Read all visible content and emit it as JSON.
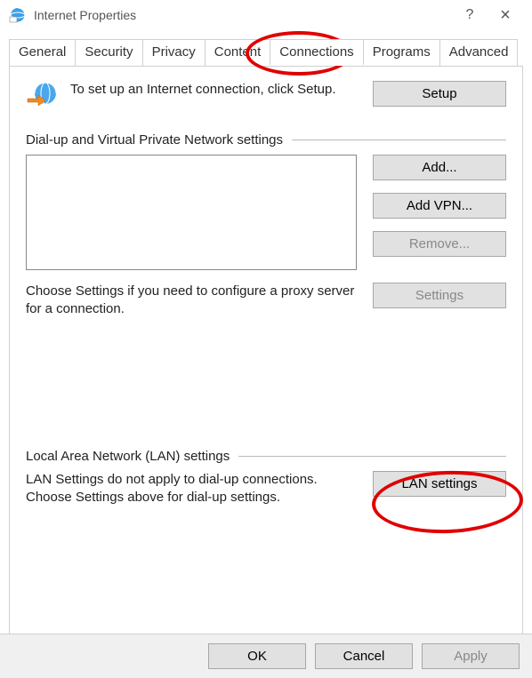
{
  "window": {
    "title": "Internet Properties",
    "help": "?",
    "close": "×"
  },
  "tabs": {
    "general": "General",
    "security": "Security",
    "privacy": "Privacy",
    "content": "Content",
    "connections": "Connections",
    "programs": "Programs",
    "advanced": "Advanced"
  },
  "setup": {
    "text": "To set up an Internet connection, click Setup.",
    "button": "Setup"
  },
  "dialup": {
    "heading": "Dial-up and Virtual Private Network settings",
    "add": "Add...",
    "add_vpn": "Add VPN...",
    "remove": "Remove...",
    "proxy_text": "Choose Settings if you need to configure a proxy server for a connection.",
    "settings": "Settings"
  },
  "lan": {
    "heading": "Local Area Network (LAN) settings",
    "text": "LAN Settings do not apply to dial-up connections. Choose Settings above for dial-up settings.",
    "button": "LAN settings"
  },
  "footer": {
    "ok": "OK",
    "cancel": "Cancel",
    "apply": "Apply"
  }
}
